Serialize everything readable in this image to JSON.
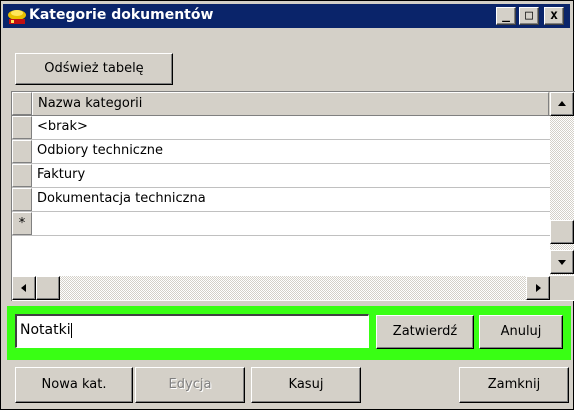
{
  "window": {
    "title": "Kategorie dokumentów",
    "controls": {
      "minimize": "_",
      "maximize": "□",
      "close": "x"
    }
  },
  "toolbar": {
    "refresh_label": "Odśwież tabelę"
  },
  "grid": {
    "column_header": "Nazwa kategorii",
    "rows": [
      "<brak>",
      "Odbiory techniczne",
      "Faktury",
      "Dokumentacja techniczna"
    ],
    "new_row_marker": "*"
  },
  "editor": {
    "value": "Notatki",
    "confirm_label": "Zatwierdź",
    "cancel_label": "Anuluj",
    "highlight_color": "#39ff14"
  },
  "actions": {
    "new_label": "Nowa kat.",
    "edit_label": "Edycja",
    "delete_label": "Kasuj",
    "close_label": "Zamknij"
  },
  "icons": {
    "app": "app-icon",
    "scroll_up": "arrow-up-icon",
    "scroll_down": "arrow-down-icon",
    "scroll_left": "arrow-left-icon",
    "scroll_right": "arrow-right-icon"
  }
}
